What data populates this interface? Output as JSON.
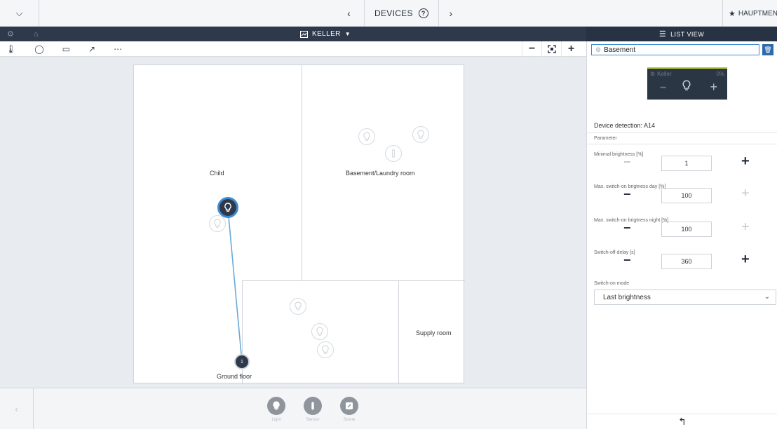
{
  "topbar": {
    "chevron_icon": "chevron-down-icon",
    "title": "DEVICES",
    "prev_icon": "chevron-left",
    "next_icon": "chevron-right",
    "favorite_label": "HAUPTMEN"
  },
  "header": {
    "floor_title": "KELLER",
    "list_view_label": "LIST VIEW"
  },
  "plan": {
    "rooms": [
      {
        "label": "Child"
      },
      {
        "label": "Basement/Laundry room"
      },
      {
        "label": "Supply room"
      },
      {
        "label": "Ground floor"
      }
    ],
    "node_number": "1",
    "link_color": "#6aaad8"
  },
  "bottom_bar": {
    "items": [
      {
        "label": "Light",
        "icon": "bulb-icon"
      },
      {
        "label": "Sensor",
        "icon": "sensor-icon"
      },
      {
        "label": "Scene",
        "icon": "scene-icon"
      }
    ]
  },
  "panel": {
    "room_value": "Basement",
    "tile": {
      "name": "Keller",
      "percent": "0%"
    },
    "device_detection": "Device detection: A14",
    "section_label": "Parameter",
    "params": [
      {
        "label": "Minimal brightness [%]",
        "value": "1"
      },
      {
        "label": "Max. switch-on brigtness day [%]",
        "value": "100"
      },
      {
        "label": "Max. switch-on brigtness night [%]",
        "value": "100"
      },
      {
        "label": "Switch-off delay [s]",
        "value": "360"
      }
    ],
    "mode_label": "Switch-on mode",
    "mode_value": "Last brightness"
  },
  "colors": {
    "dark": "#2e3a4b",
    "accent": "#3f8dd0",
    "tile_accent": "#b9c92c"
  }
}
